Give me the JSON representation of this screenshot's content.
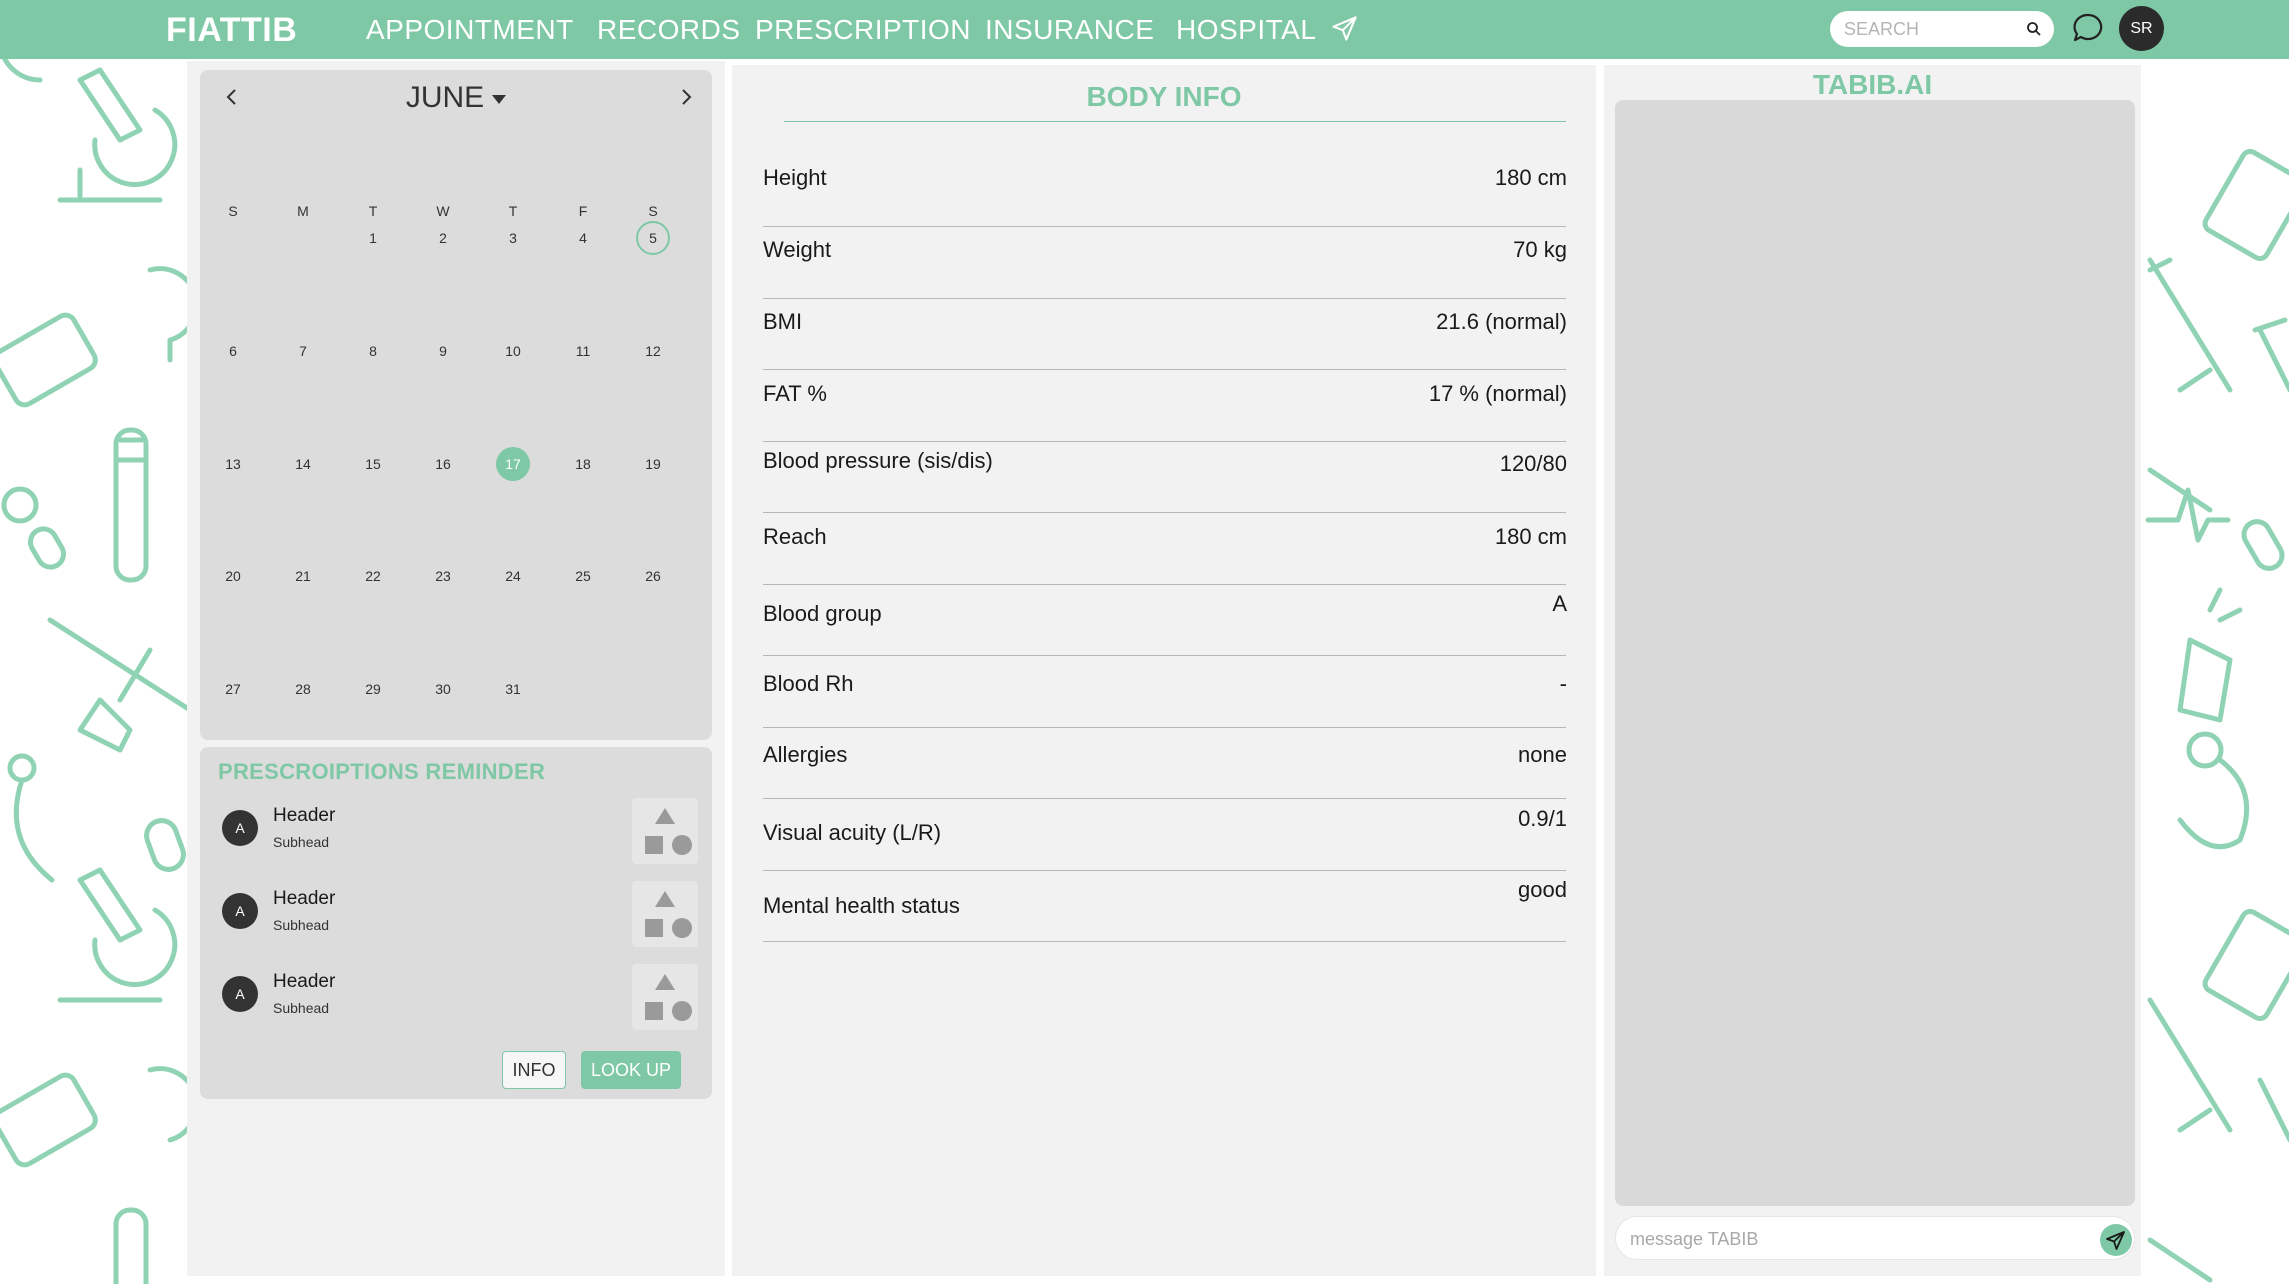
{
  "colors": {
    "accent": "#7fc8a6",
    "panel": "#f2f2f2",
    "card": "#dcdcdc",
    "dark": "#2b2b2b"
  },
  "navbar": {
    "brand": "FIATTIB",
    "items": [
      "APPOINTMENT",
      "RECORDS",
      "PRESCRIPTION",
      "INSURANCE",
      "HOSPITAL"
    ],
    "search_placeholder": "SEARCH",
    "avatar_initials": "SR",
    "icons": {
      "send": "send-icon",
      "search": "search-icon",
      "chat": "chat-bubble-icon"
    }
  },
  "calendar": {
    "month": "JUNE",
    "weekdays": [
      "S",
      "M",
      "T",
      "W",
      "T",
      "F",
      "S"
    ],
    "days": [
      1,
      2,
      3,
      4,
      5,
      6,
      7,
      8,
      9,
      10,
      11,
      12,
      13,
      14,
      15,
      16,
      17,
      18,
      19,
      20,
      21,
      22,
      23,
      24,
      25,
      26,
      27,
      28,
      29,
      30,
      31
    ],
    "first_weekday_index": 2,
    "today": 5,
    "selected": 17
  },
  "reminder": {
    "title": "PRESCROIPTIONS REMINDER",
    "items": [
      {
        "avatar": "A",
        "header": "Header",
        "subhead": "Subhead"
      },
      {
        "avatar": "A",
        "header": "Header",
        "subhead": "Subhead"
      },
      {
        "avatar": "A",
        "header": "Header",
        "subhead": "Subhead"
      }
    ],
    "info_label": "INFO",
    "lookup_label": "LOOK UP"
  },
  "body_info": {
    "title": "BODY INFO",
    "rows": [
      {
        "label": "Height",
        "value": "180 cm"
      },
      {
        "label": "Weight",
        "value": "70 kg"
      },
      {
        "label": "BMI",
        "value": "21.6 (normal)"
      },
      {
        "label": "FAT %",
        "value": "17 % (normal)"
      },
      {
        "label": "Blood pressure (sis/dis)",
        "value": "120/80"
      },
      {
        "label": "Reach",
        "value": "180 cm"
      },
      {
        "label": "Blood group",
        "value": "A"
      },
      {
        "label": "Blood Rh",
        "value": "-"
      },
      {
        "label": "Allergies",
        "value": "none"
      },
      {
        "label": "Visual acuity (L/R)",
        "value": "0.9/1"
      },
      {
        "label": "Mental health status",
        "value": "good"
      }
    ]
  },
  "ai": {
    "title": "TABIB.AI",
    "input_placeholder": "message TABIB"
  }
}
